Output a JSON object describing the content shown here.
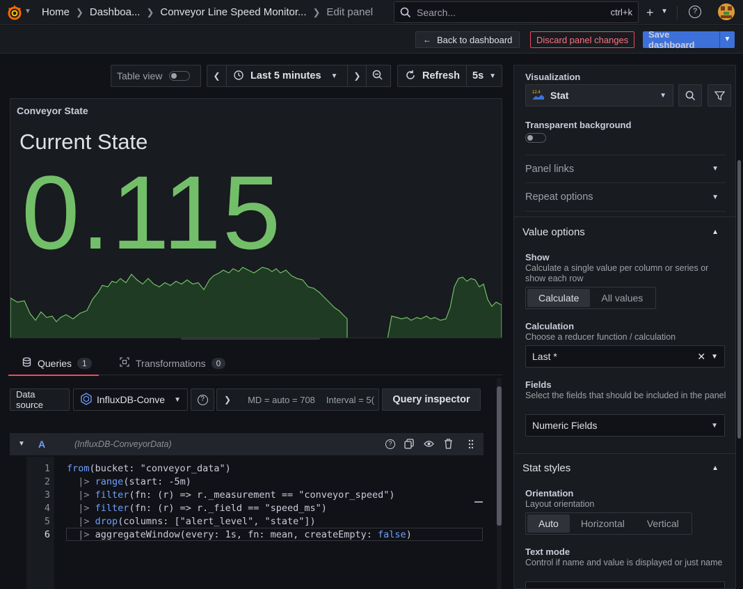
{
  "topbar": {
    "breadcrumbs": [
      "Home",
      "Dashboa...",
      "Conveyor Line Speed Monitor...",
      "Edit panel"
    ],
    "search_placeholder": "Search...",
    "search_shortcut": "ctrl+k"
  },
  "subbar": {
    "back_label": "Back to dashboard",
    "discard_label": "Discard panel changes",
    "save_label": "Save dashboard"
  },
  "toolbar": {
    "table_view_label": "Table view",
    "time_range": "Last 5 minutes",
    "refresh_label": "Refresh",
    "refresh_interval": "5s"
  },
  "panel": {
    "title": "Conveyor State",
    "stat_name": "Current State",
    "stat_value": "0.115",
    "color": "#73bf69"
  },
  "tabs": {
    "queries_label": "Queries",
    "queries_count": "1",
    "transformations_label": "Transformations",
    "transformations_count": "0"
  },
  "query_row": {
    "datasource_label": "Data source",
    "datasource_value": "InfluxDB-Conve",
    "md_label": "MD = auto = 708",
    "interval_label": "Interval = 5(",
    "inspector_label": "Query inspector"
  },
  "query": {
    "ref_id": "A",
    "datasource_hint": "(InfluxDB-ConveyorData)",
    "line_numbers": [
      "1",
      "2",
      "3",
      "4",
      "5",
      "6"
    ]
  },
  "sidebar": {
    "visualization_label": "Visualization",
    "visualization_value": "Stat",
    "transparent_label": "Transparent background",
    "panel_links_label": "Panel links",
    "repeat_label": "Repeat options",
    "value_options_label": "Value options",
    "show_label": "Show",
    "show_desc": "Calculate a single value per column or series or show each row",
    "show_options": [
      "Calculate",
      "All values"
    ],
    "calculation_label": "Calculation",
    "calculation_desc": "Choose a reducer function / calculation",
    "calculation_value": "Last *",
    "fields_label": "Fields",
    "fields_desc": "Select the fields that should be included in the panel",
    "fields_value": "Numeric Fields",
    "stat_styles_label": "Stat styles",
    "orientation_label": "Orientation",
    "orientation_desc": "Layout orientation",
    "orientation_options": [
      "Auto",
      "Horizontal",
      "Vertical"
    ],
    "text_mode_label": "Text mode",
    "text_mode_desc": "Control if name and value is displayed or just name"
  }
}
